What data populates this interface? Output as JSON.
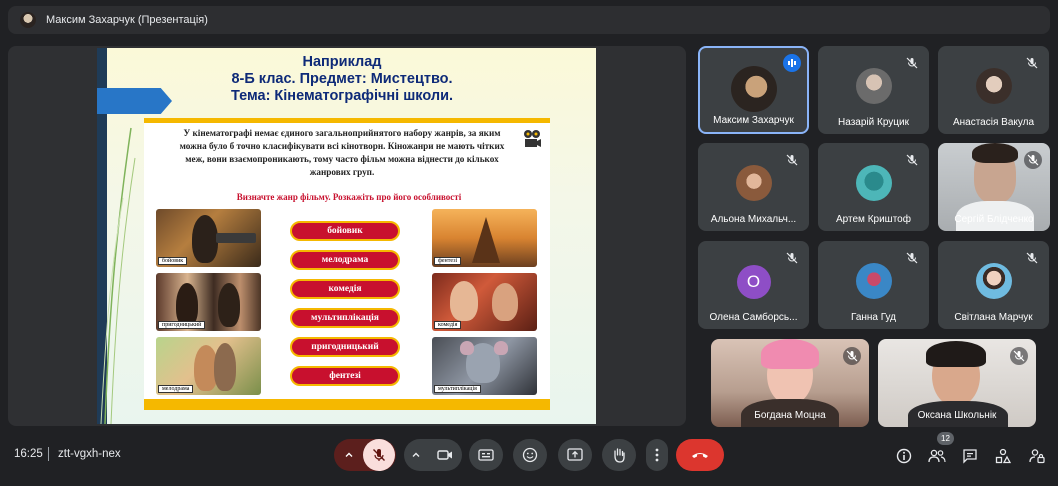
{
  "presenter": {
    "title": "Максим Захарчук (Презентація)",
    "avatar_icon": "presenter-avatar"
  },
  "slide": {
    "heading": [
      "Наприклад",
      "8-Б клас. Предмет: Мистецтво.",
      "Тема: Кінематографічні школи."
    ],
    "paragraph": "У кінематографі немає єдиного загальноприйнятого набору жанрів, за яким можна було б точно класифікувати всі кінотворн. Кіножанри не мають чітких меж, вони взаємопроникають, тому часто фільм можна віднести до кількох жанрових груп.",
    "task": "Визначте жанр фільму. Розкажіть про його особливості",
    "genres": [
      "бойовик",
      "мелодрама",
      "комедія",
      "мультиплікація",
      "пригодницький",
      "фентезі"
    ],
    "picture_captions": {
      "action": "бойовик",
      "adventure": "пригодницький",
      "melodrama": "мелодрама",
      "fantasy": "фентезі",
      "comedy": "комедія",
      "cartoon": "мультиплікація"
    },
    "accent_color": "#c8102e",
    "border_color": "#f5b800",
    "heading_color": "#0e2a78"
  },
  "participants": [
    {
      "name": "Максим Захарчук",
      "speaking": true,
      "active": true
    },
    {
      "name": "Назарій Круцик",
      "muted": true
    },
    {
      "name": "Анастасія Вакула",
      "muted": true
    },
    {
      "name": "Альона Михальч...",
      "muted": true
    },
    {
      "name": "Артем Криштоф",
      "muted": true
    },
    {
      "name": "Сергій Блідченко",
      "muted": true,
      "video": true
    },
    {
      "name": "Олена Самборсь...",
      "muted": true,
      "letter": "О"
    },
    {
      "name": "Ганна Гуд",
      "muted": true
    },
    {
      "name": "Світлана Марчук",
      "muted": true
    },
    {
      "name": "Богдана Моцна",
      "muted": true,
      "video": true
    },
    {
      "name": "Оксана Школьнік",
      "muted": true,
      "video": true
    }
  ],
  "bottom_bar": {
    "time": "16:25",
    "meeting_code": "ztt-vgxh-nex",
    "people_count": "12",
    "controls": [
      "mic-options-chevron",
      "mic-off-icon",
      "camera-options-chevron",
      "camera-icon",
      "captions-icon",
      "emoji-icon",
      "present-icon",
      "raise-hand-icon",
      "more-options-icon",
      "end-call-icon"
    ],
    "right_icons": [
      "info-icon",
      "people-icon",
      "chat-icon",
      "activities-icon",
      "host-controls-icon"
    ]
  }
}
